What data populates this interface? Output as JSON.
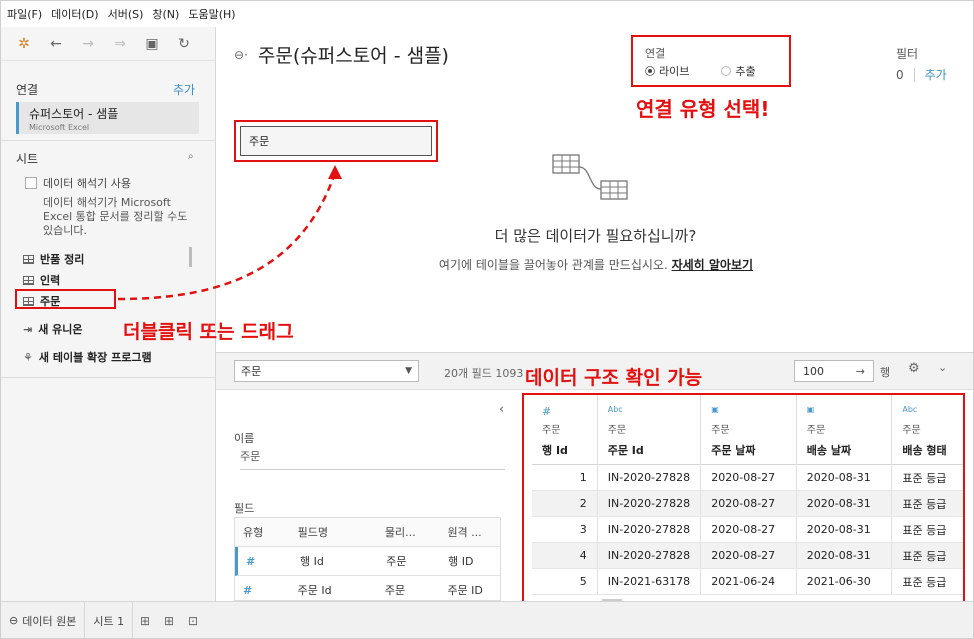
{
  "menu": [
    "파일(F)",
    "데이터(D)",
    "서버(S)",
    "창(N)",
    "도움말(H)"
  ],
  "left": {
    "connections_title": "연결",
    "add_label": "추가",
    "connection_name": "슈퍼스토어 - 샘플",
    "connection_type": "Microsoft Excel",
    "sheets_title": "시트",
    "interpreter_checkbox": "데이터 해석기 사용",
    "interpreter_desc": "데이터 해석기가 Microsoft Excel 통합 문서를 정리할 수도 있습니다.",
    "sheets": [
      "반품 정리",
      "인력",
      "주문"
    ],
    "new_union": "새 유니온",
    "new_extension": "새 테이블 확장 프로그램"
  },
  "header": {
    "ds_title": "주문(슈퍼스토어 - 샘플)",
    "connection_label": "연결",
    "live_label": "라이브",
    "extract_label": "추출",
    "filter_label": "필터",
    "filter_count": "0",
    "filter_add": "추가"
  },
  "canvas": {
    "table_name": "주문",
    "more_data_title": "더 많은 데이터가 필요하십니까?",
    "more_data_sub": "여기에 테이블을 끌어놓아 관계를 만드십시오.",
    "learn_more": "자세히 알아보기"
  },
  "annotations": {
    "conn_type": "연결 유형 선택!",
    "drag": "더블클릭 또는 드래그",
    "structure": "데이터 구조 확인 가능"
  },
  "lower": {
    "table_select": "주문",
    "field_info": "20개 필드 1093",
    "rows_value": "100",
    "rows_label": "행"
  },
  "meta": {
    "name_label": "이름",
    "name_value": "주문",
    "fields_label": "필드",
    "columns": [
      "유형",
      "필드명",
      "물리...",
      "원격 ..."
    ],
    "rows": [
      [
        "#",
        "행 Id",
        "주문",
        "행 ID"
      ],
      [
        "#",
        "주문 Id",
        "주문",
        "주문 ID"
      ]
    ]
  },
  "grid": {
    "headers": [
      {
        "type": "#",
        "table": "주문",
        "field": "행 Id"
      },
      {
        "type": "Abc",
        "table": "주문",
        "field": "주문 Id"
      },
      {
        "type": "date",
        "table": "주문",
        "field": "주문 날짜"
      },
      {
        "type": "date",
        "table": "주문",
        "field": "배송 날짜"
      },
      {
        "type": "Abc",
        "table": "주문",
        "field": "배송 형태"
      }
    ],
    "rows": [
      [
        "1",
        "IN-2020-27828",
        "2020-08-27",
        "2020-08-31",
        "표준 등급"
      ],
      [
        "2",
        "IN-2020-27828",
        "2020-08-27",
        "2020-08-31",
        "표준 등급"
      ],
      [
        "3",
        "IN-2020-27828",
        "2020-08-27",
        "2020-08-31",
        "표준 등급"
      ],
      [
        "4",
        "IN-2020-27828",
        "2020-08-27",
        "2020-08-31",
        "표준 등급"
      ],
      [
        "5",
        "IN-2021-63178",
        "2021-06-24",
        "2021-06-30",
        "표준 등급"
      ]
    ]
  },
  "status": {
    "datasource_tab": "데이터 원본",
    "sheet_tab": "시트 1"
  },
  "colors": {
    "accent": "#4b98c9",
    "annotation_red": "#e31010"
  }
}
